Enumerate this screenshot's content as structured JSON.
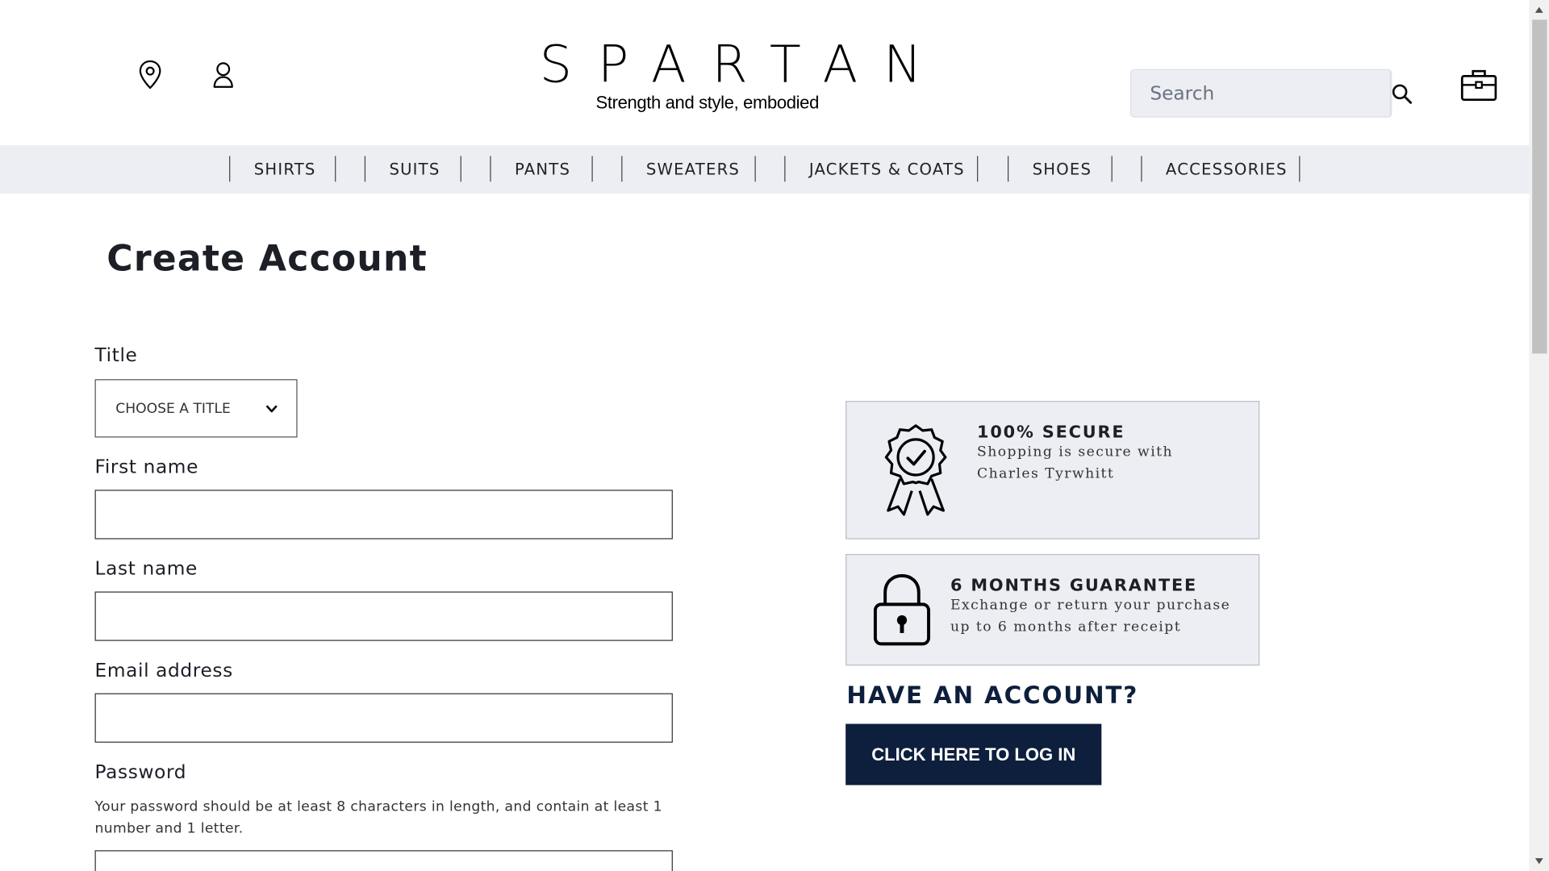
{
  "header": {
    "brand": "SPARTAN",
    "tagline": "Strength and style, embodied",
    "search_placeholder": "Search"
  },
  "icons": {
    "location": "map-pin-icon",
    "account": "user-icon",
    "search": "magnifier-icon",
    "bag": "briefcase-bag-icon"
  },
  "nav": {
    "items": [
      "SHIRTS",
      "SUITS",
      "PANTS",
      "SWEATERS",
      "JACKETS & COATS",
      "SHOES",
      "ACCESSORIES"
    ]
  },
  "form": {
    "page_title": "Create Account",
    "title_label": "Title",
    "title_select_value": "CHOOSE A TITLE",
    "first_name_label": "First name",
    "first_name_value": "",
    "last_name_label": "Last name",
    "last_name_value": "",
    "email_label": "Email address",
    "email_value": "",
    "password_label": "Password",
    "password_hint": "Your password should be at least 8 characters in length, and contain at least 1 number and 1 letter.",
    "password_value": ""
  },
  "cards": {
    "secure_title": "100% SECURE",
    "secure_text": "Shopping is secure with Charles Tyrwhitt",
    "guarantee_title": "6 MONTHS GUARANTEE",
    "guarantee_text": "Exchange or return your purchase up to 6 months after receipt"
  },
  "login": {
    "heading": "HAVE AN ACCOUNT?",
    "button_label": "CLICK HERE TO LOG IN"
  },
  "colors": {
    "nav_bg": "#eceef3",
    "brand_navy": "#0d1f3c",
    "card_bg": "#eceef3"
  }
}
